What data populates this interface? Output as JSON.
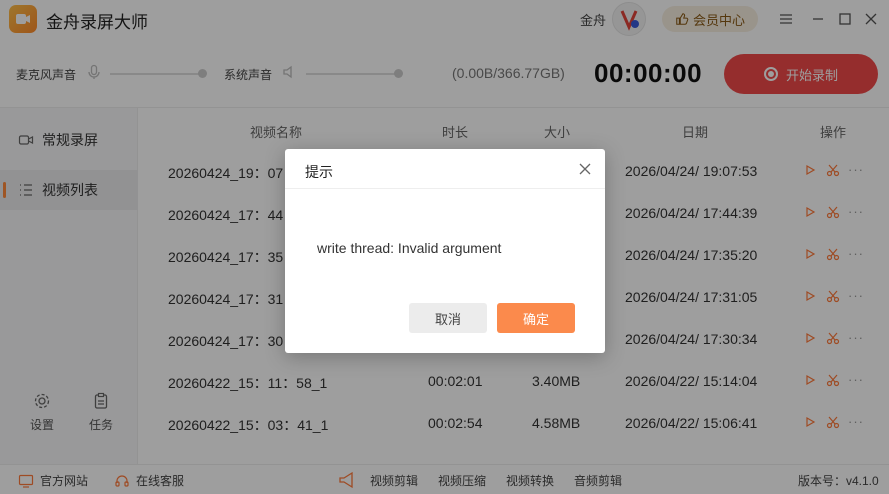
{
  "app": {
    "title": "金舟录屏大师",
    "user_name": "金舟",
    "member_label": "会员中心"
  },
  "recorder": {
    "mic_label": "麦克风声音",
    "system_label": "系统声音",
    "disk_usage": "(0.00B/366.77GB)",
    "timer": "00:00:00",
    "start_label": "开始录制"
  },
  "sidebar": {
    "items": [
      {
        "label": "常规录屏",
        "icon": "screen-record-icon"
      },
      {
        "label": "视频列表",
        "icon": "list-icon"
      }
    ],
    "settings_label": "设置",
    "tasks_label": "任务"
  },
  "table": {
    "columns": [
      "视频名称",
      "时长",
      "大小",
      "日期",
      "操作"
    ],
    "rows": [
      {
        "name": "20260424_19：07",
        "duration": "",
        "size": "",
        "date": "2026/04/24/ 19:07:53"
      },
      {
        "name": "20260424_17：44",
        "duration": "",
        "size": "",
        "date": "2026/04/24/ 17:44:39"
      },
      {
        "name": "20260424_17：35",
        "duration": "",
        "size": "",
        "date": "2026/04/24/ 17:35:20"
      },
      {
        "name": "20260424_17：31",
        "duration": "",
        "size": "",
        "date": "2026/04/24/ 17:31:05"
      },
      {
        "name": "20260424_17：30",
        "duration": "",
        "size": "",
        "date": "2026/04/24/ 17:30:34"
      },
      {
        "name": "20260422_15：11：58_1",
        "duration": "00:02:01",
        "size": "3.40MB",
        "date": "2026/04/22/ 15:14:04"
      },
      {
        "name": "20260422_15：03：41_1",
        "duration": "00:02:54",
        "size": "4.58MB",
        "date": "2026/04/22/ 15:06:41"
      }
    ],
    "more_symbol": "···"
  },
  "footer": {
    "website": "官方网站",
    "support": "在线客服",
    "tools": [
      "视频剪辑",
      "视频压缩",
      "视频转换",
      "音频剪辑"
    ],
    "version": "版本号：v4.1.0"
  },
  "dialog": {
    "title": "提示",
    "message": "write  thread: Invalid argument",
    "cancel_label": "取消",
    "ok_label": "确定"
  },
  "colors": {
    "accent": "#f04a4a",
    "orange": "#fb8a4c",
    "action": "#ff7a3a"
  }
}
